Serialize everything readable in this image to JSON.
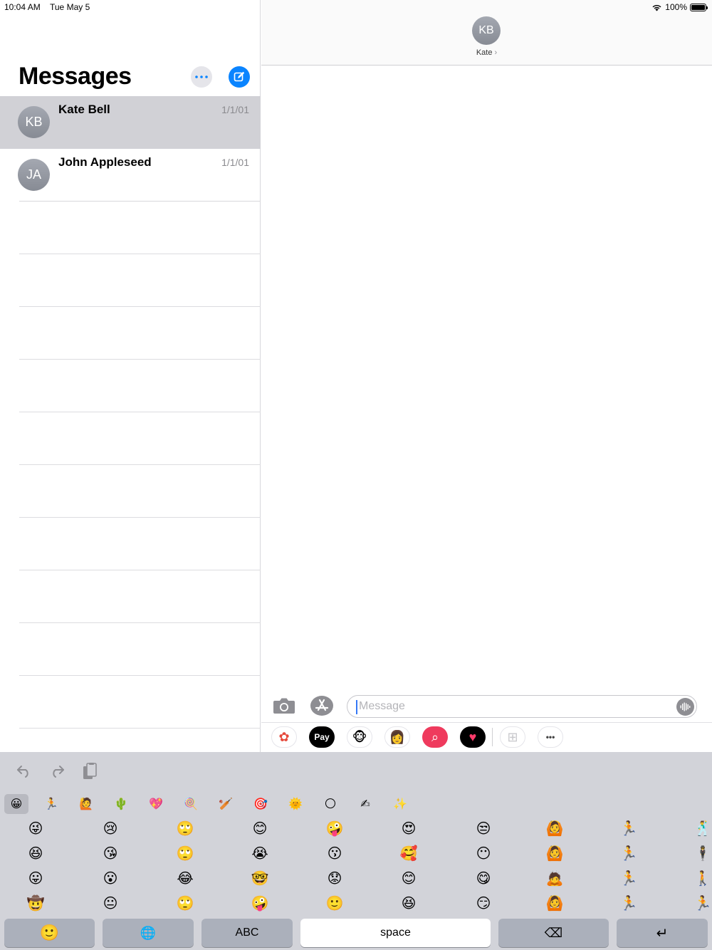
{
  "status_bar": {
    "time": "10:04 AM",
    "date": "Tue May 5",
    "battery": "100%"
  },
  "sidebar": {
    "title": "Messages",
    "conversations": [
      {
        "initials": "KB",
        "name": "Kate Bell",
        "date": "1/1/01",
        "selected": true
      },
      {
        "initials": "JA",
        "name": "John Appleseed",
        "date": "1/1/01",
        "selected": false
      }
    ]
  },
  "conversation": {
    "contact_initials": "KB",
    "contact_name": "Kate",
    "chevron": "›"
  },
  "compose": {
    "placeholder": "Message"
  },
  "app_strip": [
    {
      "name": "photos-app-icon",
      "glyph": "✿",
      "bg": "#ffffff",
      "color": "#e64a3c"
    },
    {
      "name": "apple-pay-app-icon",
      "glyph": "Pay",
      "bg": "#000000",
      "color": "#ffffff"
    },
    {
      "name": "animoji-app-icon",
      "glyph": "🐵",
      "bg": "#ffffff",
      "color": "#000000"
    },
    {
      "name": "memoji-app-icon",
      "glyph": "👩",
      "bg": "#ffffff",
      "color": "#000000"
    },
    {
      "name": "image-search-app-icon",
      "glyph": "⌕",
      "bg": "#ef3a5d",
      "color": "#ffffff"
    },
    {
      "name": "digital-touch-app-icon",
      "glyph": "♥",
      "bg": "#000000",
      "color": "#ff3b6b"
    },
    {
      "name": "sticker-grid-app-icon",
      "glyph": "⊞",
      "bg": "#ffffff",
      "color": "#c8c8cc"
    },
    {
      "name": "more-apps-icon",
      "glyph": "•••",
      "bg": "#ffffff",
      "color": "#444444"
    }
  ],
  "keyboard": {
    "categories": [
      "😀",
      "🏃",
      "🙋",
      "🌵",
      "💖",
      "🍭",
      "🏏",
      "🎯",
      "🌞",
      "🌕",
      "✍",
      "✨"
    ],
    "emoji_rows": [
      [
        "😜",
        "😢",
        "🙄",
        "😊",
        "🤪",
        "😍",
        "😒",
        "🙆",
        "🏃",
        "🕺"
      ],
      [
        "😆",
        "😘",
        "🙄",
        "😭",
        "😗",
        "🥰",
        "😶",
        "🙆",
        "🏃",
        "🕴"
      ],
      [
        "😛",
        "😮",
        "😂",
        "🤓",
        "😟",
        "😊",
        "😋",
        "🙇",
        "🏃",
        "🚶"
      ],
      [
        "🤠",
        "😐",
        "🙄",
        "🤪",
        "🙂",
        "😆",
        "😏",
        "🙆",
        "🏃",
        "🏃"
      ]
    ],
    "keys": {
      "emoji": "🙂",
      "globe": "🌐",
      "abc": "ABC",
      "space": "space",
      "delete": "⌫",
      "return": "↵"
    }
  }
}
